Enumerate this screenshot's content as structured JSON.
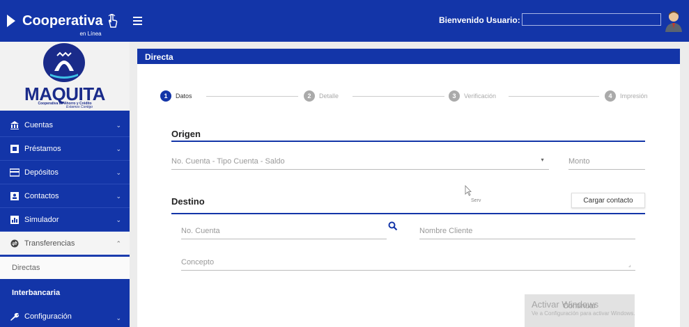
{
  "header": {
    "brand": "Cooperativa",
    "brand_sub": "en Línea",
    "welcome": "Bienvenido Usuario:"
  },
  "sidebar": {
    "logo": {
      "name": "MAQUITA",
      "tagline": "Cooperativa de Ahorro y Crédito",
      "slogan": "Estamos Contigo"
    },
    "items": [
      {
        "label": "Cuentas",
        "icon": "bank-icon"
      },
      {
        "label": "Préstamos",
        "icon": "loan-icon"
      },
      {
        "label": "Depósitos",
        "icon": "deposit-icon"
      },
      {
        "label": "Contactos",
        "icon": "contacts-icon"
      },
      {
        "label": "Simulador",
        "icon": "chart-icon"
      },
      {
        "label": "Transferencias",
        "icon": "transfer-icon"
      },
      {
        "label": "Configuración",
        "icon": "wrench-icon"
      }
    ],
    "subitems": [
      {
        "label": "Directas"
      },
      {
        "label": "Interbancaria"
      }
    ]
  },
  "panel": {
    "title": "Directa"
  },
  "steps": [
    {
      "num": "1",
      "label": "Datos"
    },
    {
      "num": "2",
      "label": "Detalle"
    },
    {
      "num": "3",
      "label": "Verificación"
    },
    {
      "num": "4",
      "label": "Impresión"
    }
  ],
  "origen": {
    "title": "Origen",
    "account_placeholder": "No. Cuenta - Tipo Cuenta - Saldo",
    "amount_placeholder": "Monto"
  },
  "destino": {
    "title": "Destino",
    "load_contact": "Cargar contacto",
    "cursor_label": "Serv",
    "account_placeholder": "No. Cuenta",
    "client_placeholder": "Nombre Cliente",
    "concept_placeholder": "Concepto"
  },
  "windows_notice": {
    "title": "Activar Windows",
    "overlay_label": "Continuar",
    "subtitle": "Ve a Configuración para activar Windows."
  },
  "colors": {
    "primary": "#1335a8",
    "inactive_step": "#aaaaaa"
  }
}
